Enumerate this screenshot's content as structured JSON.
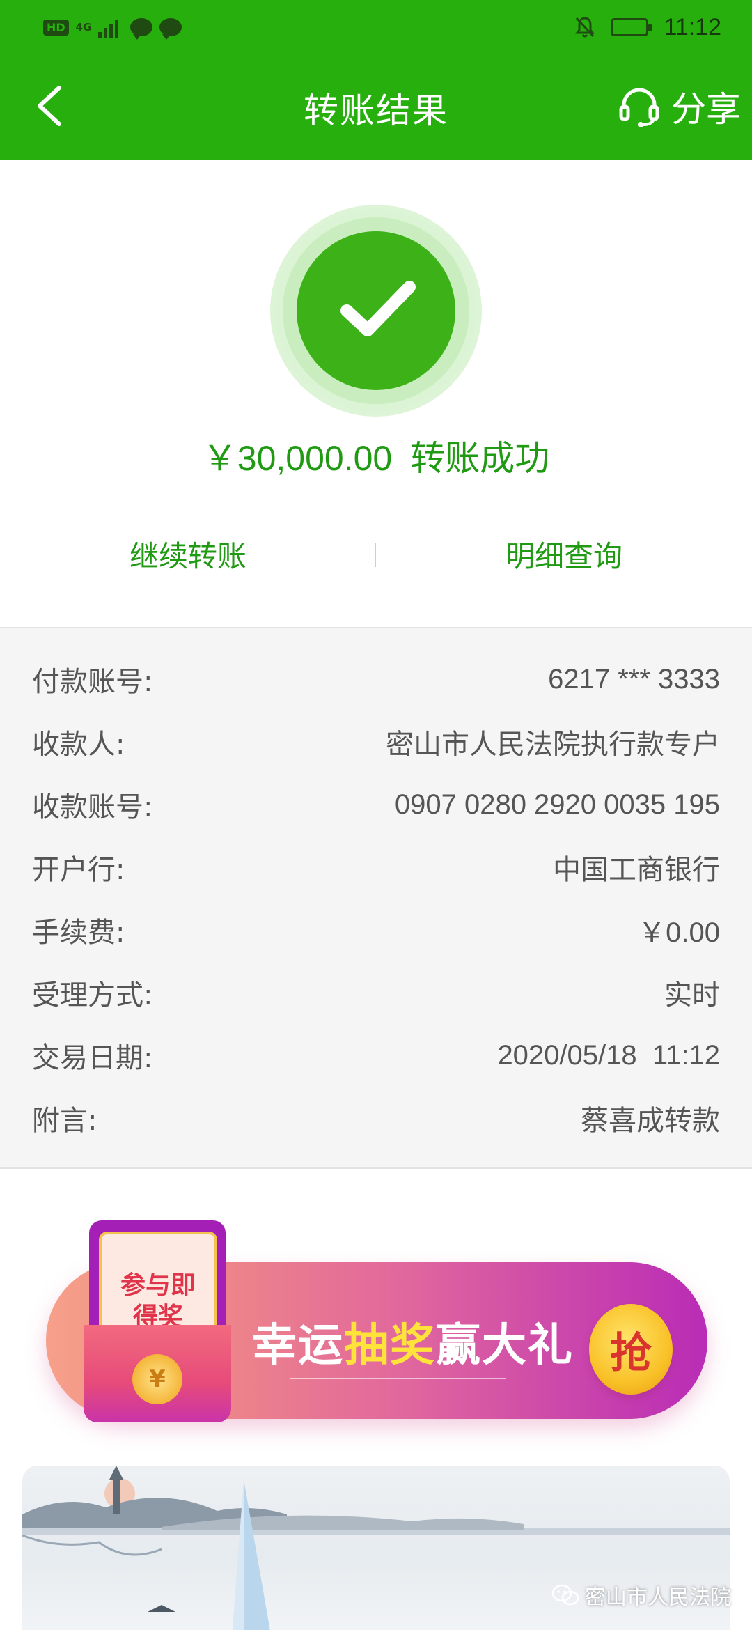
{
  "status_bar": {
    "hd": "HD",
    "network": "4G",
    "time": "11:12"
  },
  "nav": {
    "title": "转账结果",
    "share_label": "分享"
  },
  "result": {
    "amount": "￥30,000.00",
    "status": "转账成功"
  },
  "actions": {
    "continue_transfer": "继续转账",
    "details_query": "明细查询"
  },
  "details": [
    {
      "label": "付款账号:",
      "value": "6217 *** 3333"
    },
    {
      "label": "收款人:",
      "value": "密山市人民法院执行款专户"
    },
    {
      "label": "收款账号:",
      "value": "0907 0280 2920 0035 195"
    },
    {
      "label": "开户行:",
      "value": "中国工商银行"
    },
    {
      "label": "手续费:",
      "value": "￥0.00"
    },
    {
      "label": "受理方式:",
      "value": "实时"
    },
    {
      "label": "交易日期:",
      "value": "2020/05/18  11:12"
    },
    {
      "label": "附言:",
      "value": "蔡喜成转款"
    }
  ],
  "banner": {
    "envelope_text": "参与即得奖",
    "text_a": "幸运",
    "text_highlight": "抽奖",
    "text_b": "赢大礼",
    "grab_label": "抢",
    "coin_symbol": "¥"
  },
  "watermark": "密山市人民法院",
  "colors": {
    "header_green": "#27b00d",
    "accent_green": "#1f9a12",
    "detail_bg": "#f5f5f5"
  },
  "icons": [
    "back-arrow-icon",
    "customer-service-headset-icon",
    "success-check-icon",
    "wechat-icon"
  ]
}
